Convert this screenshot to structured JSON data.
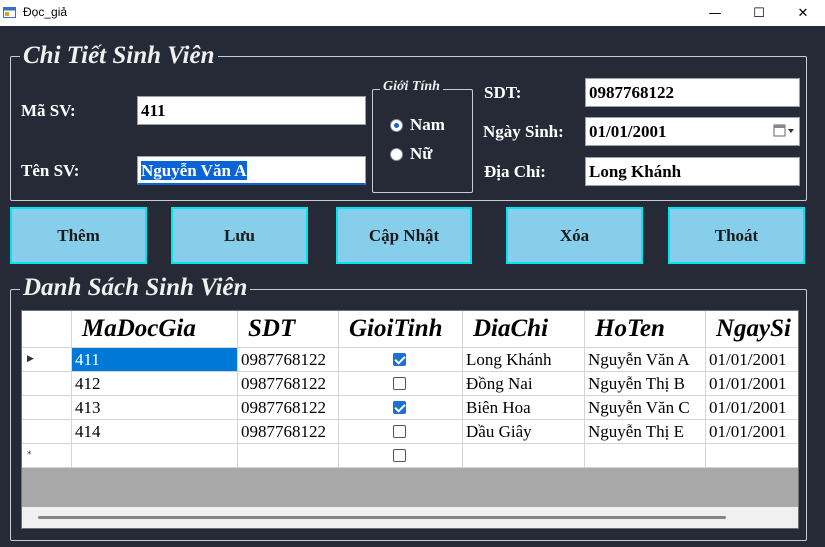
{
  "window": {
    "title": "Đọc_giả",
    "minimize": "—",
    "maximize": "☐",
    "close": "✕"
  },
  "details": {
    "group_title": "Chi Tiết Sinh Viên",
    "ma_sv_label": "Mã SV:",
    "ma_sv_value": "411",
    "ten_sv_label": "Tên SV:",
    "ten_sv_value": "Nguyễn Văn A",
    "gender_group_title": "Giới Tính",
    "gender_male": "Nam",
    "gender_female": "Nữ",
    "gender_selected": "Nam",
    "sdt_label": "SDT:",
    "sdt_value": "0987768122",
    "ngay_sinh_label": "Ngày Sinh:",
    "ngay_sinh_value": "01/01/2001",
    "dia_chi_label": "Địa Chỉ:",
    "dia_chi_value": "Long Khánh"
  },
  "buttons": {
    "add": "Thêm",
    "save": "Lưu",
    "update": "Cập Nhật",
    "delete": "Xóa",
    "exit": "Thoát"
  },
  "list": {
    "group_title": "Danh Sách Sinh Viên",
    "columns": [
      "MaDocGia",
      "SDT",
      "GioiTinh",
      "DiaChi",
      "HoTen",
      "NgaySi"
    ],
    "rows": [
      {
        "ma": "411",
        "sdt": "0987768122",
        "gioitinh": true,
        "diachi": "Long Khánh",
        "hoten": "Nguyễn Văn A",
        "ngaysinh": "01/01/2001"
      },
      {
        "ma": "412",
        "sdt": "0987768122",
        "gioitinh": false,
        "diachi": "Đồng Nai",
        "hoten": "Nguyễn Thị B",
        "ngaysinh": "01/01/2001"
      },
      {
        "ma": "413",
        "sdt": "0987768122",
        "gioitinh": true,
        "diachi": "Biên Hoa",
        "hoten": "Nguyễn Văn C",
        "ngaysinh": "01/01/2001"
      },
      {
        "ma": "414",
        "sdt": "0987768122",
        "gioitinh": false,
        "diachi": "Dầu Giây",
        "hoten": "Nguyễn Thị E",
        "ngaysinh": "01/01/2001"
      }
    ],
    "current_row_marker": "▶",
    "new_row_marker": "*"
  },
  "colors": {
    "background": "#252a36",
    "button_fill": "#87ceeb",
    "button_border": "#00e5ee",
    "selection": "#0078d7"
  }
}
